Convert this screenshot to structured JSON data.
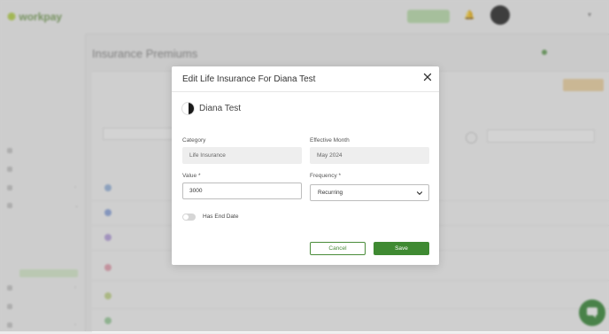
{
  "app": {
    "logo": "workpay",
    "top_pill": "",
    "user": {
      "name": "",
      "sub_prefix": "",
      "sub_link": ""
    }
  },
  "sidebar": {
    "sub_items": [
      "",
      "",
      "",
      "",
      "",
      "",
      "",
      "",
      "",
      "",
      ""
    ],
    "sections": [
      "",
      "",
      "",
      "",
      ""
    ],
    "benefit_items": [
      "",
      "",
      "",
      "",
      "",
      "",
      ""
    ],
    "bottom_sections": [
      "",
      "",
      ""
    ]
  },
  "page": {
    "title": "Insurance Premiums",
    "link": "",
    "tab": "",
    "filter_label": "",
    "filter_value": "",
    "search_placeholder": "",
    "column_header": "",
    "rows": [
      {
        "name": "",
        "sub": "",
        "v1": "",
        "v2": "",
        "color": "#9bb8e0"
      },
      {
        "name": "",
        "sub": "",
        "v1": "",
        "v2": "",
        "color": "#b9a4e0"
      },
      {
        "name": "",
        "sub": "",
        "v1": "",
        "v2": "",
        "color": "#e8a4b4"
      },
      {
        "name": "",
        "sub": "",
        "v1": "",
        "v2": "",
        "color": "#c7d98f"
      },
      {
        "name": "",
        "sub": "",
        "v1": "",
        "v2": "",
        "color": "#9fd0a0"
      }
    ]
  },
  "modal": {
    "title": "Edit Life Insurance For Diana Test",
    "employee_name": "Diana Test",
    "category_label": "Category",
    "category_value": "Life Insurance",
    "effective_month_label": "Effective Month",
    "effective_month_value": "May 2024",
    "value_label": "Value *",
    "value_value": "3000",
    "frequency_label": "Frequency *",
    "frequency_value": "Recurring",
    "has_end_date_label": "Has End Date",
    "has_end_date_on": false,
    "cancel_label": "Cancel",
    "save_label": "Save"
  },
  "colors": {
    "accent": "#3f8a32",
    "accent_light": "#dcefd0",
    "overlay": "rgba(110,110,110,0.30)"
  }
}
